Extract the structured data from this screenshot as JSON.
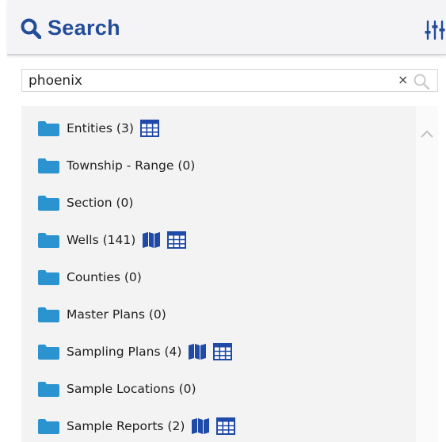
{
  "header": {
    "title": "Search",
    "search_icon": "search-icon",
    "filter_icon": "sliders-icon"
  },
  "search": {
    "value": "phoenix",
    "placeholder": "",
    "clear_label": "×",
    "submit_icon": "magnifier-icon"
  },
  "colors": {
    "brand": "#234c99",
    "folder": "#2b93cf",
    "action_icon": "#1f4aa8"
  },
  "results": {
    "items": [
      {
        "label": "Entities (3)",
        "actions": [
          "table-icon"
        ]
      },
      {
        "label": "Township - Range (0)",
        "actions": []
      },
      {
        "label": "Section (0)",
        "actions": []
      },
      {
        "label": "Wells (141)",
        "actions": [
          "map-icon",
          "table-icon"
        ]
      },
      {
        "label": "Counties (0)",
        "actions": []
      },
      {
        "label": "Master Plans (0)",
        "actions": []
      },
      {
        "label": "Sampling Plans (4)",
        "actions": [
          "map-icon",
          "table-icon"
        ]
      },
      {
        "label": "Sample Locations (0)",
        "actions": []
      },
      {
        "label": "Sample Reports (2)",
        "actions": [
          "map-icon",
          "table-icon"
        ]
      }
    ]
  }
}
